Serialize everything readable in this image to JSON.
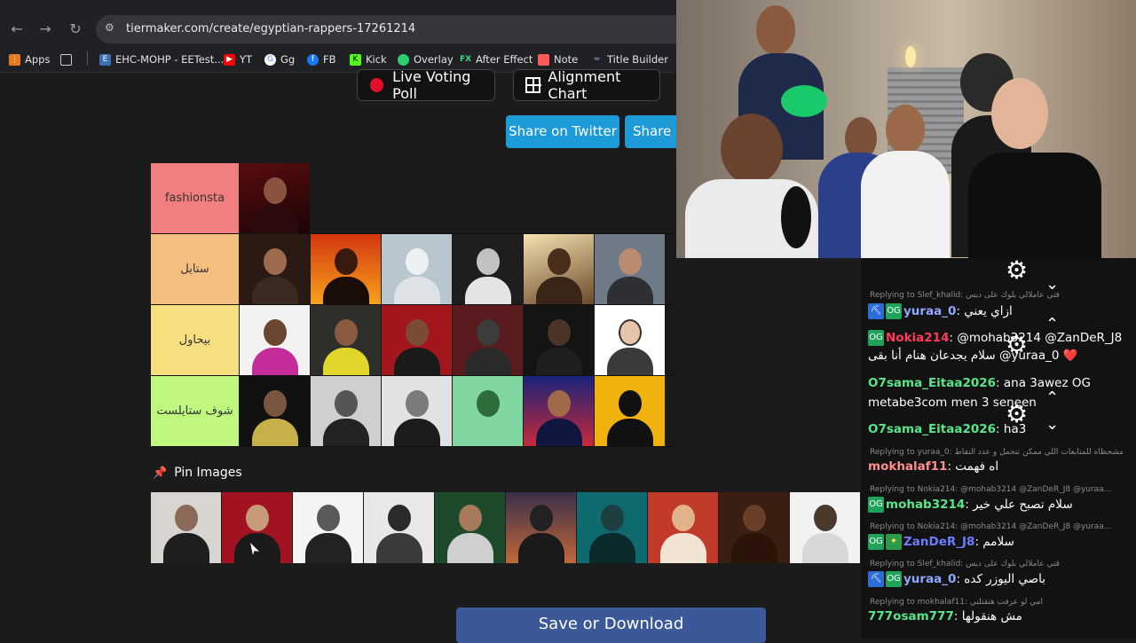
{
  "browser": {
    "url": "tiermaker.com/create/egyptian-rappers-17261214",
    "bookmarks": [
      "Apps",
      "EHC-MOHP - EETest...",
      "YT",
      "Gg",
      "FB",
      "Kick",
      "Overlay",
      "After Effect",
      "Note",
      "Title Builder"
    ]
  },
  "page": {
    "live_voting_label": "Live Voting Poll",
    "alignment_chart_label": "Alignment Chart",
    "share_twitter_label": "Share on Twitter",
    "share_other_label": "Share o",
    "tiers": [
      {
        "label": "fashionsta",
        "color": "#f27f7f",
        "count": 1
      },
      {
        "label": "ستايل",
        "color": "#f5bf80",
        "count": 6
      },
      {
        "label": "بيحاول",
        "color": "#f7df80",
        "count": 6
      },
      {
        "label": "شوف ستايلست",
        "color": "#bff77f",
        "count": 6
      }
    ],
    "pin_images_label": "Pin Images",
    "save_label": "Save or Download"
  },
  "chat": {
    "messages": [
      {
        "reply": "Replying to Slef_khalid: قتي عاملالي بلوك على ديس",
        "badges": [
          "pickaxe",
          "og"
        ],
        "user": "yuraa_0",
        "user_color": "#8fa7ff",
        "text": "ازاي يعني"
      },
      {
        "reply": "",
        "badges": [
          "og"
        ],
        "user": "Nokia214",
        "user_color": "#ff3b5c",
        "text": "@mohab3214 @ZanDeR_J8"
      },
      {
        "reply": "",
        "badges": [],
        "user": "",
        "user_color": "#ffffff",
        "text": "سلام يجدعان هنام أنا بقى @yuraa_0 ❤️"
      },
      {
        "reply": "",
        "badges": [],
        "user": "O7sama_Eitaa2026",
        "user_color": "#58e68b",
        "text": "ana 3awez OG"
      },
      {
        "reply": "",
        "badges": [],
        "user": "",
        "user_color": "#ffffff",
        "text": "metabe3com men 3 seneen"
      },
      {
        "reply": "",
        "badges": [],
        "user": "O7sama_Eitaa2026",
        "user_color": "#58e68b",
        "text": "ha3"
      },
      {
        "reply": "Replying to yuraa_0: عليها مشحظاه للمتابعات اللي ممكن تتحمل و عدد النقاط",
        "badges": [],
        "user": "mokhalaf11",
        "user_color": "#ff8f8f",
        "text": "اه فهمت"
      },
      {
        "reply": "Replying to Nokia214: @mohab3214 @ZanDeR_J8 @yuraa...",
        "badges": [
          "og"
        ],
        "user": "mohab3214",
        "user_color": "#58e68b",
        "text": "سلام تصبح علي خير"
      },
      {
        "reply": "Replying to Nokia214: @mohab3214 @ZanDeR_J8 @yuraa...",
        "badges": [
          "og",
          "star"
        ],
        "user": "ZanDeR_J8",
        "user_color": "#6a7dff",
        "text": "سلامم"
      },
      {
        "reply": "Replying to Slef_khalid: قتي عاملالي بلوك على ديس",
        "badges": [
          "pickaxe",
          "og"
        ],
        "user": "yuraa_0",
        "user_color": "#8fa7ff",
        "text": "باصي اليوزر كده"
      },
      {
        "reply": "Replying to mokhalaf11: امي لو عرفت هتقتلني",
        "badges": [],
        "user": "777osam777",
        "user_color": "#58e68b",
        "text": "مش هنقولها"
      }
    ]
  }
}
